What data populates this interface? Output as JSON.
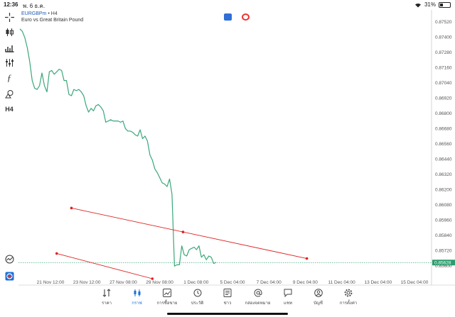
{
  "status_bar": {
    "time": "12:36",
    "date": "พ. 6 ธ.ค.",
    "battery": "31%",
    "battery_level": 0.31
  },
  "symbol": {
    "name": "EURGBPm",
    "separator": "•",
    "timeframe": "H4",
    "description": "Euro vs Great Britain Pound"
  },
  "toolbar": {
    "timeframe_label": "H4"
  },
  "price_axis": {
    "labels": [
      "0.87520",
      "0.87400",
      "0.87280",
      "0.87160",
      "0.87040",
      "0.86920",
      "0.86800",
      "0.86680",
      "0.86560",
      "0.86440",
      "0.86320",
      "0.86200",
      "0.86080",
      "0.85960",
      "0.85840",
      "0.85720",
      "0.85600"
    ],
    "current_price": "0.85628"
  },
  "time_axis": {
    "labels": [
      "21 Nov 12:00",
      "23 Nov 12:00",
      "27 Nov 08:00",
      "29 Nov 08:00",
      "1 Dec 08:00",
      "5 Dec 04:00",
      "7 Dec 04:00",
      "9 Dec 04:00",
      "11 Dec 04:00",
      "13 Dec 04:00",
      "15 Dec 04:00"
    ]
  },
  "chart_data": {
    "type": "line",
    "series": [
      {
        "values": [
          0.8748,
          0.8746,
          0.8741,
          0.8733,
          0.8722,
          0.8707,
          0.8701,
          0.87,
          0.8703,
          0.8713,
          0.8703,
          0.8698,
          0.8714,
          0.8715,
          0.8712,
          0.8714,
          0.8716,
          0.8715,
          0.8707,
          0.8707,
          0.8696,
          0.8695,
          0.87,
          0.8699,
          0.87,
          0.8698,
          0.8695,
          0.8687,
          0.8682,
          0.8685,
          0.8683,
          0.8687,
          0.8688,
          0.8686,
          0.8683,
          0.8674,
          0.8675,
          0.8676,
          0.8675,
          0.8675,
          0.8675,
          0.8674,
          0.8675,
          0.8669,
          0.8667,
          0.8667,
          0.8666,
          0.8664,
          0.8663,
          0.8668,
          0.8661,
          0.8663,
          0.8659,
          0.8648,
          0.8644,
          0.8637,
          0.8634,
          0.863,
          0.8626,
          0.8625,
          0.8623,
          0.8629,
          0.8617,
          0.856,
          0.8561,
          0.8561,
          0.8576,
          0.8569,
          0.8568,
          0.8573,
          0.8574,
          0.8575,
          0.8573,
          0.8576,
          0.8567,
          0.8569,
          0.8565,
          0.8568,
          0.8567,
          0.8562,
          0.8563
        ]
      }
    ],
    "trendlines": [
      {
        "color": "#e02020",
        "from": {
          "x_index": 21,
          "y": 0.8606
        },
        "to": {
          "x_index": 117,
          "y": 0.8566
        }
      },
      {
        "color": "#e02020",
        "from": {
          "x_index": 15,
          "y": 0.857
        },
        "to": {
          "x_index": 54,
          "y": 0.855
        }
      }
    ],
    "current_price_line": 0.85628,
    "ylim": [
      0.855,
      0.8754
    ],
    "grid": false,
    "line_color": "#3aa77a"
  },
  "bottom_nav": {
    "items": [
      {
        "label": "ราคา",
        "icon": "quotes-icon",
        "active": false
      },
      {
        "label": "กราฟ",
        "icon": "chart-icon",
        "active": true
      },
      {
        "label": "การซื้อขาย",
        "icon": "trade-icon",
        "active": false
      },
      {
        "label": "ประวัติ",
        "icon": "history-icon",
        "active": false
      },
      {
        "label": "ข่าว",
        "icon": "news-icon",
        "active": false
      },
      {
        "label": "กล่องจดหมาย",
        "icon": "mailbox-icon",
        "active": false
      },
      {
        "label": "แชท",
        "icon": "chat-icon",
        "active": false
      },
      {
        "label": "บัญชี",
        "icon": "account-icon",
        "active": false
      },
      {
        "label": "การตั้งค่า",
        "icon": "settings-icon",
        "active": false
      }
    ]
  }
}
